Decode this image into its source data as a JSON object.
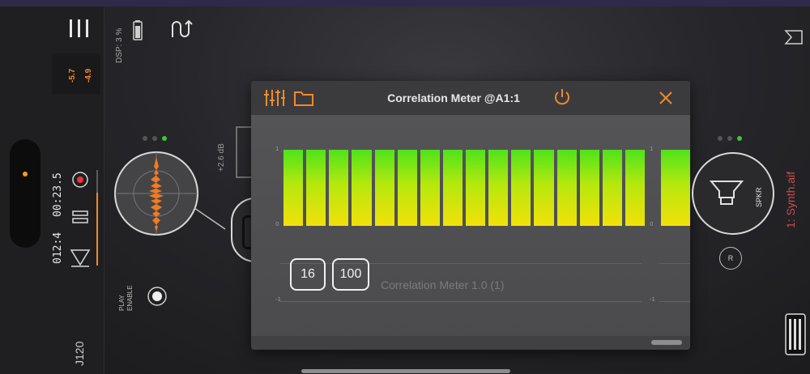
{
  "toolbar": {
    "dsp_label": "DSP: 3 %"
  },
  "meter": {
    "left_value": "-5.7",
    "right_value": "-4.9"
  },
  "transport": {
    "time": "00:23.5",
    "position": "012:4",
    "tempo": "J120",
    "play_enable_label": "PLAY\nENABLE"
  },
  "node": {
    "gain_label": "+2.6 dB"
  },
  "plugin_window": {
    "title": "Correlation Meter @A1:1",
    "accent_color": "#f08a2a",
    "scale_top": "1",
    "scale_mid": "0",
    "scale_bottom": "-1",
    "button_a": "16",
    "button_b": "100",
    "version_label": "Correlation Meter 1.0 (1)",
    "bar_count": 16
  },
  "output": {
    "speaker_label": "SPKR",
    "r_label": "R",
    "track_name": "1: Synth.aif",
    "track_color": "#d24a4a"
  },
  "page_dots": {
    "left_active_index": 2,
    "right_active_index": 2,
    "active_color": "#3ec43e"
  }
}
